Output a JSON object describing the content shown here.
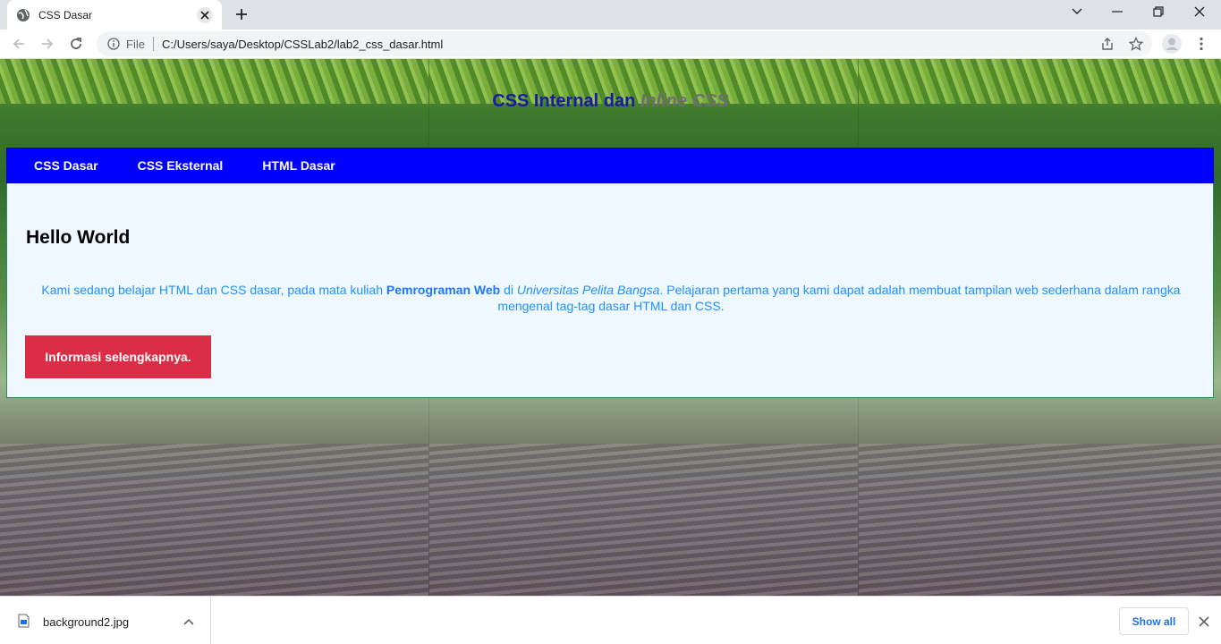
{
  "browser": {
    "tab_title": "CSS Dasar",
    "omnibox_scheme": "File",
    "url": "C:/Users/saya/Desktop/CSSLab2/lab2_css_dasar.html"
  },
  "page": {
    "title_main": "CSS Internal dan",
    "title_italic": "Inline CSS",
    "nav": [
      "CSS Dasar",
      "CSS Eksternal",
      "HTML Dasar"
    ],
    "heading": "Hello World",
    "para": {
      "part1": "Kami sedang belajar HTML dan CSS dasar, pada mata kuliah ",
      "bold": "Pemrograman Web",
      "part2": " di ",
      "italic": "Universitas Pelita Bangsa",
      "part3": ". Pelajaran pertama yang kami dapat adalah membuat tampilan web sederhana dalam rangka mengenal tag-tag dasar HTML dan CSS."
    },
    "button": "Informasi selengkapnya.",
    "colors": {
      "nav_bg": "#0000ff",
      "content_bg": "#f0f8ff",
      "text": "#1e90ff",
      "button_bg": "#dc2d46"
    }
  },
  "downloads": {
    "file_name": "background2.jpg",
    "show_all": "Show all"
  }
}
